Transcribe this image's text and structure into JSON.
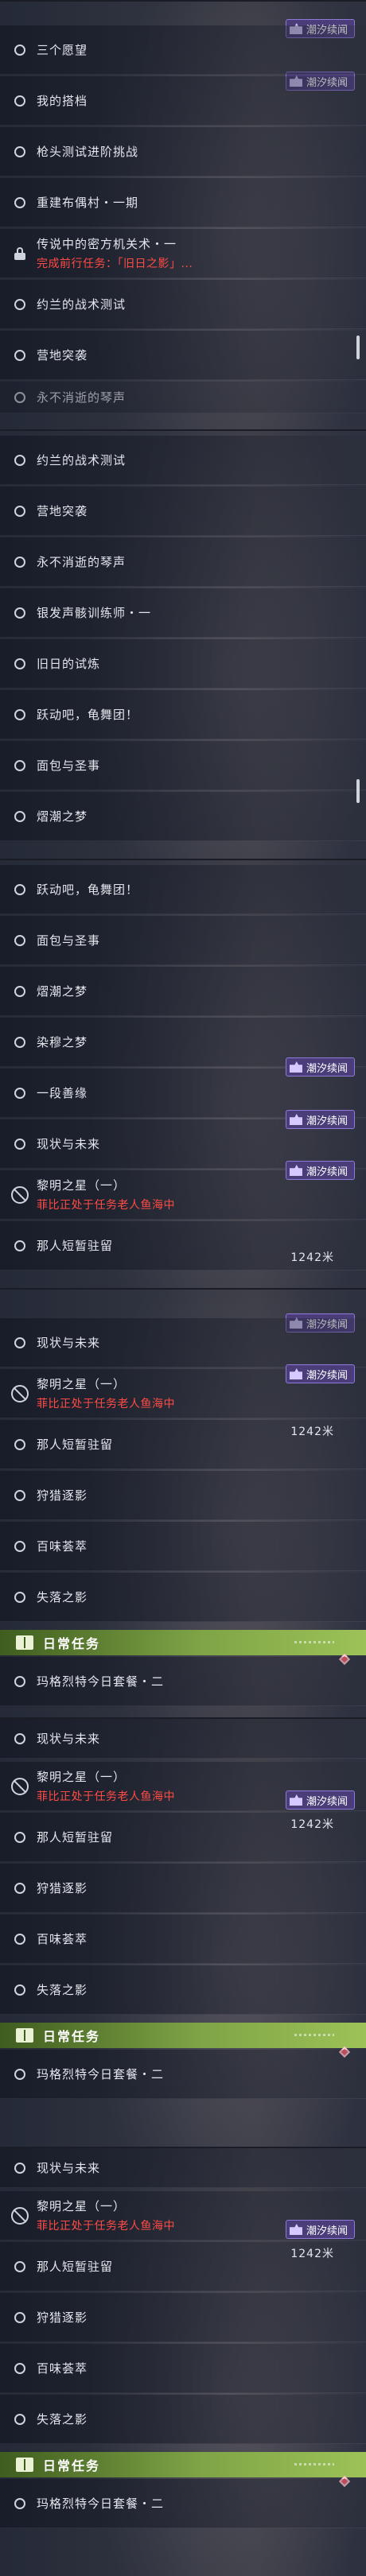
{
  "badge_label": "潮汐续闻",
  "section_label": "日常任务",
  "distance": "1242米",
  "panels": [
    {
      "rows": [
        {
          "label": "三个愿望"
        },
        {
          "label": "我的搭档"
        },
        {
          "label": "枪头测试进阶挑战"
        },
        {
          "label": "重建布偶村・一期"
        },
        {
          "label": "传说中的密方机关术・一",
          "sub": "完成前行任务：「旧日之影」..."
        },
        {
          "label": "约兰的战术测试"
        },
        {
          "label": "营地突袭"
        },
        {
          "label": "永不消逝的琴声"
        }
      ]
    },
    {
      "rows": [
        {
          "label": "约兰的战术测试"
        },
        {
          "label": "营地突袭"
        },
        {
          "label": "永不消逝的琴声"
        },
        {
          "label": "银发声骸训练师・一"
        },
        {
          "label": "旧日的试炼"
        },
        {
          "label": "跃动吧，龟舞团！"
        },
        {
          "label": "面包与圣事"
        },
        {
          "label": "熠潮之梦"
        }
      ]
    },
    {
      "rows": [
        {
          "label": "跃动吧，龟舞团！"
        },
        {
          "label": "面包与圣事"
        },
        {
          "label": "熠潮之梦"
        },
        {
          "label": "染穆之梦"
        },
        {
          "label": "一段善缘"
        },
        {
          "label": "现状与未来"
        },
        {
          "label": "黎明之星（一）",
          "sub": "菲比正处于任务老人鱼海中"
        },
        {
          "label": "那人短暂驻留"
        }
      ]
    },
    {
      "rows": [
        {
          "label": "现状与未来"
        },
        {
          "label": "黎明之星（一）",
          "sub": "菲比正处于任务老人鱼海中"
        },
        {
          "label": "那人短暂驻留"
        },
        {
          "label": "狩猎逐影"
        },
        {
          "label": "百味荟萃"
        },
        {
          "label": "失落之影"
        },
        {
          "label": "玛格烈特今日套餐・二"
        }
      ]
    },
    {
      "rows": [
        {
          "label": "现状与未来"
        },
        {
          "label": "黎明之星（一）",
          "sub": "菲比正处于任务老人鱼海中"
        },
        {
          "label": "那人短暂驻留"
        },
        {
          "label": "狩猎逐影"
        },
        {
          "label": "百味荟萃"
        },
        {
          "label": "失落之影"
        },
        {
          "label": "玛格烈特今日套餐・二"
        }
      ]
    },
    {
      "rows": [
        {
          "label": "现状与未来"
        },
        {
          "label": "黎明之星（一）",
          "sub": "菲比正处于任务老人鱼海中"
        },
        {
          "label": "那人短暂驻留"
        },
        {
          "label": "狩猎逐影"
        },
        {
          "label": "百味荟萃"
        },
        {
          "label": "失落之影"
        },
        {
          "label": "玛格烈特今日套餐・二"
        }
      ]
    }
  ]
}
